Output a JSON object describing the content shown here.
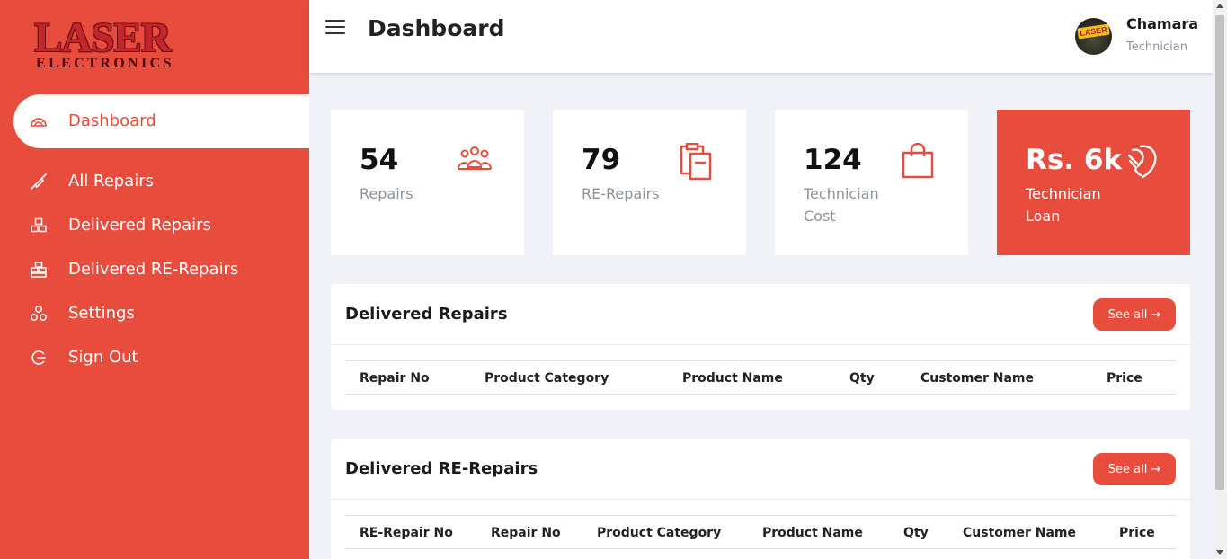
{
  "brand": {
    "logo_main": "LASER",
    "logo_sub": "ELECTRONICS"
  },
  "sidebar": {
    "items": [
      {
        "label": "Dashboard",
        "icon": "dashboard-gauge-icon",
        "active": true
      },
      {
        "label": "All Repairs",
        "icon": "screwdriver-icon"
      },
      {
        "label": "Delivered Repairs",
        "icon": "boxes-icon"
      },
      {
        "label": "Delivered RE-Repairs",
        "icon": "boxes-stacked-icon"
      },
      {
        "label": "Settings",
        "icon": "settings-circles-icon"
      },
      {
        "label": "Sign Out",
        "icon": "sign-out-icon"
      }
    ]
  },
  "header": {
    "title": "Dashboard"
  },
  "user": {
    "name": "Chamara",
    "role": "Technician",
    "avatar_text": "LASER"
  },
  "stats": [
    {
      "value": "54",
      "label": "Repairs",
      "icon": "people-group-icon"
    },
    {
      "value": "79",
      "label": "RE-Repairs",
      "icon": "clipboard-icon"
    },
    {
      "value": "124",
      "label": "Technician Cost",
      "icon": "shopping-bag-icon"
    },
    {
      "value": "Rs. 6k",
      "label": "Technician Loan",
      "icon": "hand-coin-icon"
    }
  ],
  "delivered_repairs": {
    "title": "Delivered Repairs",
    "see_all": "See all",
    "columns": [
      "Repair No",
      "Product Category",
      "Product Name",
      "Qty",
      "Customer Name",
      "Price"
    ]
  },
  "delivered_re_repairs": {
    "title": "Delivered RE-Repairs",
    "see_all": "See all",
    "columns": [
      "RE-Repair No",
      "Repair No",
      "Product Category",
      "Product Name",
      "Qty",
      "Customer Name",
      "Price"
    ]
  },
  "colors": {
    "accent": "#e84c3d",
    "background": "#f0f2f7",
    "muted_text": "#8c939c"
  }
}
